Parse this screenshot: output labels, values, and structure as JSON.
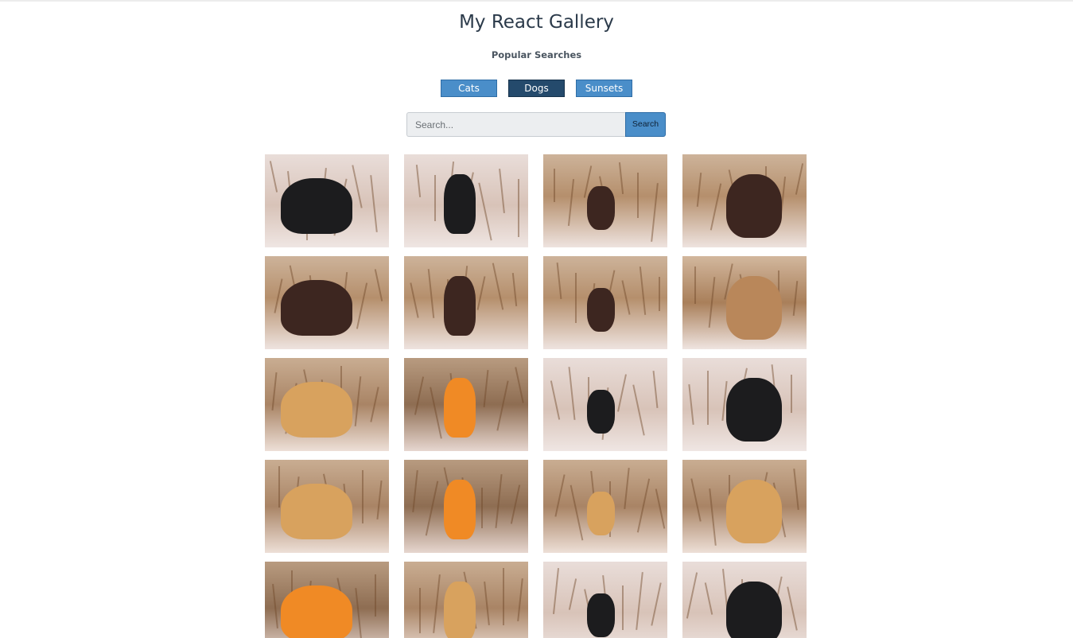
{
  "app": {
    "title": "My React Gallery",
    "subtitle": "Popular Searches"
  },
  "nav": {
    "items": [
      {
        "label": "Cats",
        "active": false
      },
      {
        "label": "Dogs",
        "active": true
      },
      {
        "label": "Sunsets",
        "active": false
      }
    ]
  },
  "search": {
    "placeholder": "Search...",
    "value": "",
    "button_label": "Search"
  },
  "colors": {
    "button": "#4a8ec9",
    "button_active": "#244a6c",
    "title": "#2b3a4a"
  },
  "gallery": {
    "photos": [
      {
        "subject": "black-dog"
      },
      {
        "subject": "black-dog"
      },
      {
        "subject": "brown-dog"
      },
      {
        "subject": "brown-dog"
      },
      {
        "subject": "brown-dog"
      },
      {
        "subject": "brown-dog"
      },
      {
        "subject": "brown-dog"
      },
      {
        "subject": "field"
      },
      {
        "subject": "yellow-dog"
      },
      {
        "subject": "hunter"
      },
      {
        "subject": "black-dog"
      },
      {
        "subject": "black-dog"
      },
      {
        "subject": "yellow-dog"
      },
      {
        "subject": "hunter"
      },
      {
        "subject": "yellow-dog"
      },
      {
        "subject": "yellow-dog"
      },
      {
        "subject": "hunter"
      },
      {
        "subject": "yellow-dog"
      },
      {
        "subject": "black-dog"
      },
      {
        "subject": "black-dog"
      }
    ]
  }
}
